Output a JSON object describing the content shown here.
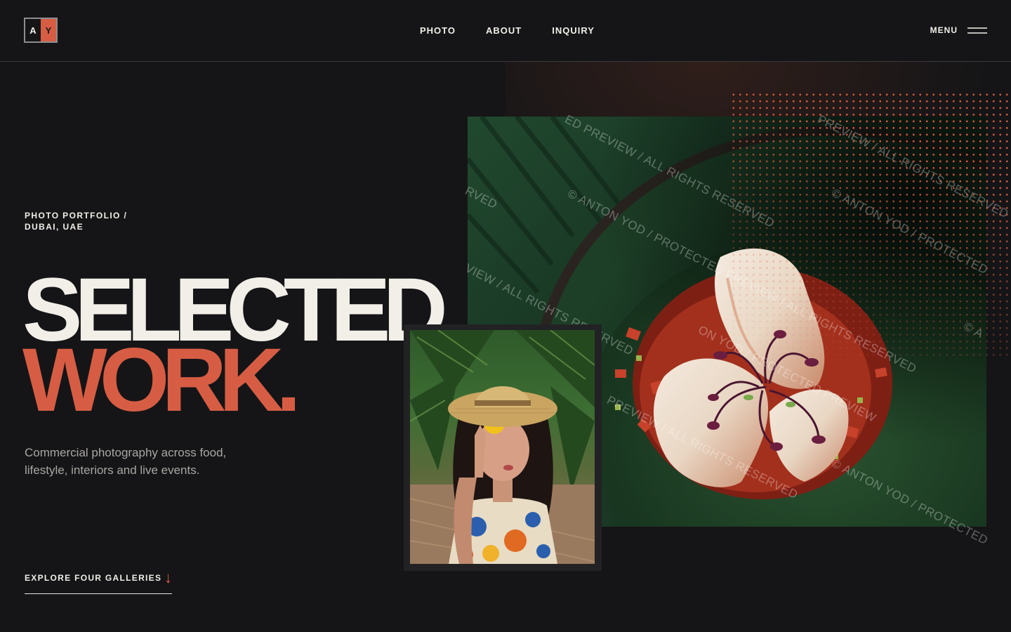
{
  "logo": {
    "left": "A",
    "right": "Y"
  },
  "nav": {
    "items": [
      {
        "label": "PHOTO"
      },
      {
        "label": "ABOUT"
      },
      {
        "label": "INQUIRY"
      }
    ]
  },
  "menu": {
    "label": "MENU",
    "icon": "hamburger-icon"
  },
  "hero": {
    "kicker_line1": "PHOTO PORTFOLIO /",
    "kicker_line2": "DUBAI, UAE",
    "title_line1": "SELECTED",
    "title_line2": "WORK.",
    "lede": "Commercial photography across food, lifestyle, interiors and live events."
  },
  "cta": {
    "label": "EXPLORE FOUR GALLERIES",
    "icon": "arrow-down-icon"
  },
  "watermark": {
    "copyright": "© ANTON YOD / PROTECTED PREVIEW / ALL RIGHTS RESERVED",
    "preview": "PREVIEW / ALL RIGHTS RESERVED",
    "fragment_1": "RVED",
    "fragment_2": "ED PREVIEW / ALL RIGHTS RESERVED",
    "fragment_3": "© ANTON YOD / PROTECTED PREVIEW / ALL RIGHTS RESERVED",
    "fragment_4": "VIEW / ALL RIGHTS RESERVED",
    "fragment_5": "ON YOD / PROTECTED PREVIEW",
    "fragment_6": "© ANTON YOD / PROTECTED",
    "fragment_7": "© A"
  },
  "colors": {
    "accent": "#d65d44",
    "background": "#151517",
    "text": "#f2efe9",
    "muted": "#a9a7a3"
  }
}
